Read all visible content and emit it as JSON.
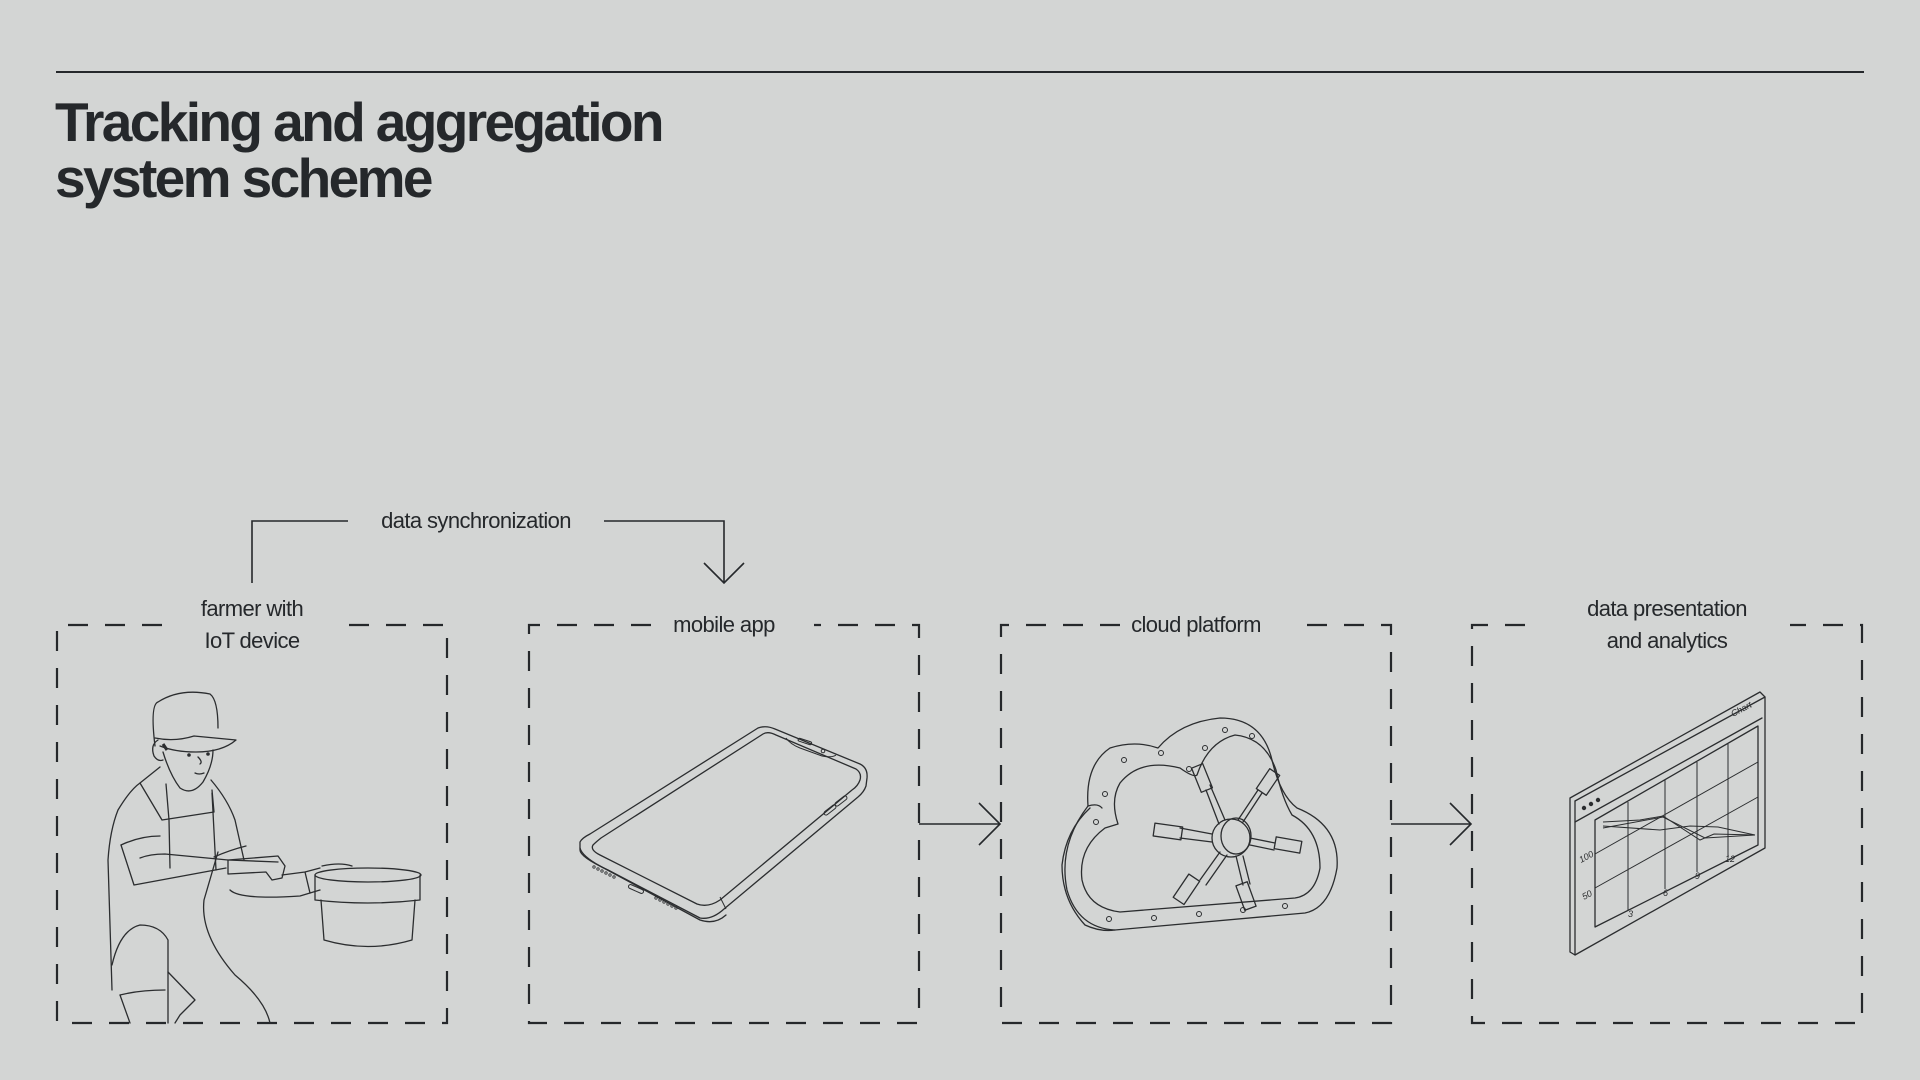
{
  "title": {
    "line1": "Tracking and aggregation",
    "line2": "system scheme"
  },
  "connector": {
    "label": "data synchronization",
    "from": "farmer with IoT device",
    "to": "mobile app"
  },
  "stages": [
    {
      "id": "farmer",
      "label_line1": "farmer with",
      "label_line2": "IoT device",
      "icon": "farmer-with-iot-device-illustration"
    },
    {
      "id": "mobile",
      "label_line1": "mobile app",
      "label_line2": "",
      "icon": "smartphone-illustration"
    },
    {
      "id": "cloud",
      "label_line1": "cloud platform",
      "label_line2": "",
      "icon": "cloud-vault-illustration"
    },
    {
      "id": "analytics",
      "label_line1": "data presentation",
      "label_line2": "and analytics",
      "icon": "chart-window-illustration"
    }
  ],
  "chart_window": {
    "title": "Chart",
    "y_ticks": [
      "100",
      "50"
    ],
    "x_ticks": [
      "3",
      "6",
      "9",
      "12"
    ]
  },
  "colors": {
    "background": "#d3d5d4",
    "ink": "#25282b"
  }
}
